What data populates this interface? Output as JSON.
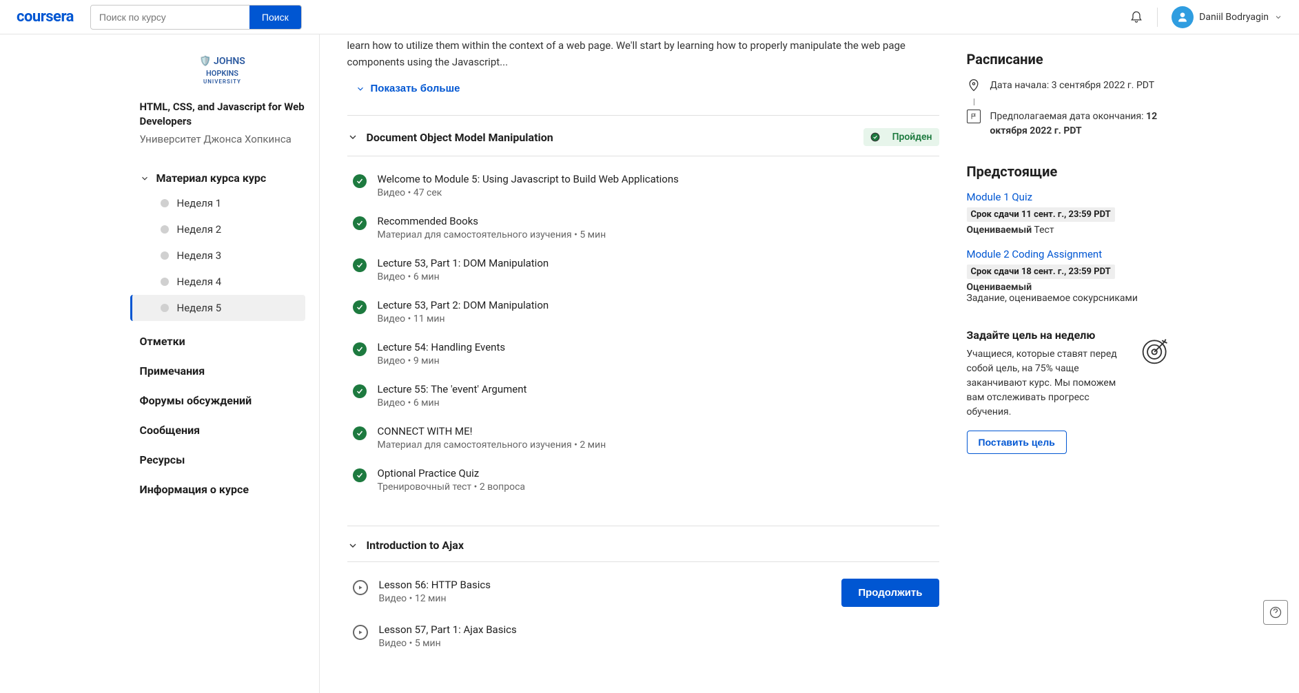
{
  "header": {
    "logo": "coursera",
    "search_placeholder": "Поиск по курсу",
    "search_button": "Поиск",
    "username": "Daniil Bodryagin"
  },
  "sidebar": {
    "university_logo_line1": "🛡️ JOHNS",
    "university_logo_line2": "HOPKINS",
    "university_logo_line3": "UNIVERSITY",
    "course_title": "HTML, CSS, and Javascript for Web Developers",
    "university_name": "Университет Джонса Хопкинса",
    "material_header": "Материал курса курс",
    "weeks": [
      {
        "label": "Неделя 1",
        "active": false
      },
      {
        "label": "Неделя 2",
        "active": false
      },
      {
        "label": "Неделя 3",
        "active": false
      },
      {
        "label": "Неделя 4",
        "active": false
      },
      {
        "label": "Неделя 5",
        "active": true
      }
    ],
    "links": [
      "Отметки",
      "Примечания",
      "Форумы обсуждений",
      "Сообщения",
      "Ресурсы",
      "Информация о курсе"
    ]
  },
  "main": {
    "description": "learn how to utilize them within the context of a web page. We'll start by learning how to properly manipulate the web page components using the Javascript...",
    "show_more": "Показать больше",
    "sections": [
      {
        "title": "Document Object Model Manipulation",
        "passed_label": "Пройден",
        "lessons": [
          {
            "title": "Welcome to Module 5: Using Javascript to Build Web Applications",
            "meta": "Видео • 47 сек",
            "done": true
          },
          {
            "title": "Recommended Books",
            "meta": "Материал для самостоятельного изучения • 5 мин",
            "done": true
          },
          {
            "title": "Lecture 53, Part 1: DOM Manipulation",
            "meta": "Видео • 6 мин",
            "done": true
          },
          {
            "title": "Lecture 53, Part 2: DOM Manipulation",
            "meta": "Видео • 11 мин",
            "done": true
          },
          {
            "title": "Lecture 54: Handling Events",
            "meta": "Видео • 9 мин",
            "done": true
          },
          {
            "title": "Lecture 55: The 'event' Argument",
            "meta": "Видео • 6 мин",
            "done": true
          },
          {
            "title": "CONNECT WITH ME!",
            "meta": "Материал для самостоятельного изучения • 2 мин",
            "done": true
          },
          {
            "title": "Optional Practice Quiz",
            "meta": "Тренировочный тест • 2 вопроса",
            "done": true
          }
        ]
      },
      {
        "title": "Introduction to Ajax",
        "passed_label": "",
        "lessons": [
          {
            "title": "Lesson 56: HTTP Basics",
            "meta": "Видео • 12 мин",
            "done": false,
            "continue": true
          },
          {
            "title": "Lesson 57, Part 1: Ajax Basics",
            "meta": "Видео • 5 мин",
            "done": false
          }
        ]
      }
    ],
    "continue_label": "Продолжить"
  },
  "right": {
    "schedule_heading": "Расписание",
    "start_prefix": "Дата начала: ",
    "start_date": "3 сентября 2022 г. PDT",
    "end_prefix": "Предполагаемая дата окончания: ",
    "end_date": "12 октября 2022 г. PDT",
    "upcoming_heading": "Предстоящие",
    "upcoming": [
      {
        "link": "Module 1 Quiz",
        "due_prefix": "Срок сдачи ",
        "due_date": "11 сент. г., 23:59 PDT",
        "sub_bold": "Оцениваемый",
        "sub_rest": " Тест"
      },
      {
        "link": "Module 2 Coding Assignment",
        "due_prefix": "Срок сдачи ",
        "due_date": "18 сент. г., 23:59 PDT",
        "sub_bold": "Оцениваемый",
        "sub_rest": "",
        "sub_line2": "Задание, оцениваемое сокурсниками"
      }
    ],
    "goal_title": "Задайте цель на неделю",
    "goal_text": "Учащиеся, которые ставят перед собой цель, на 75% чаще заканчивают курс. Мы поможем вам отслеживать прогресс обучения.",
    "goal_button": "Поставить цель"
  }
}
